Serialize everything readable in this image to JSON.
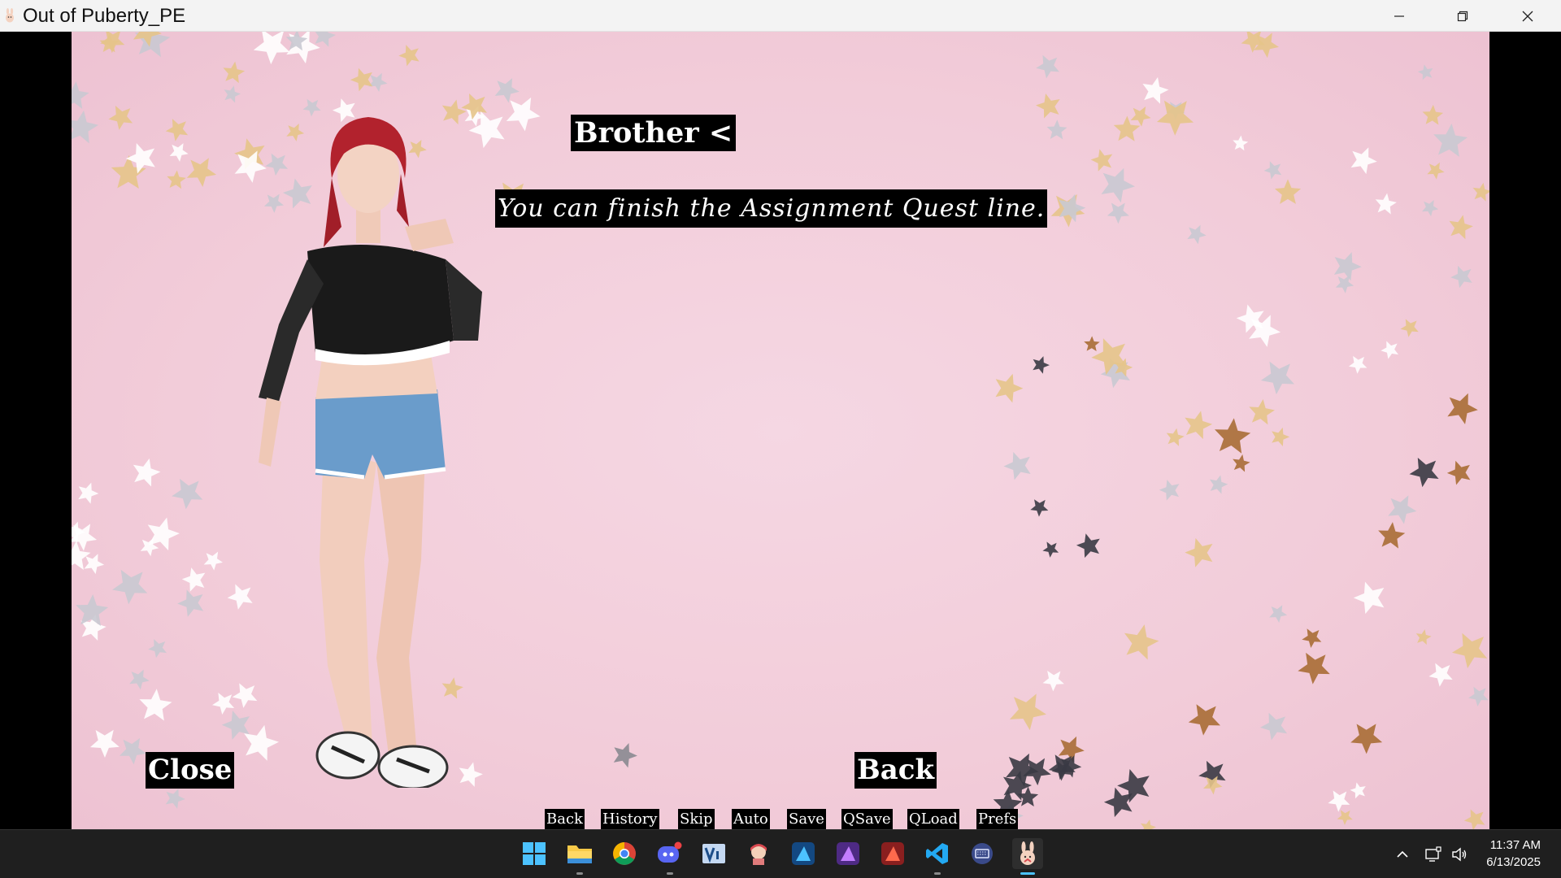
{
  "window": {
    "title": "Out of Puberty_PE",
    "controls": [
      "minimize-icon",
      "restore-icon",
      "close-icon"
    ]
  },
  "game": {
    "speaker": "Brother <",
    "dialogue": "You can finish the Assignment Quest line.",
    "close_label": "Close",
    "back_label": "Back",
    "quick_menu": [
      "Back",
      "History",
      "Skip",
      "Auto",
      "Save",
      "QSave",
      "QLoad",
      "Prefs"
    ],
    "background": "pink-with-gold-and-silver-stars",
    "character": "red-haired-girl-black-top-denim-shorts"
  },
  "taskbar": {
    "apps": [
      "windows-start-icon",
      "file-explorer-icon",
      "chrome-icon",
      "discord-icon",
      "vi-app-icon",
      "anime-avatar-icon",
      "affinity-designer-icon",
      "affinity-photo-icon",
      "affinity-publisher-icon",
      "vscode-icon",
      "keyboard-app-icon",
      "game-bunny-icon"
    ],
    "time": "11:37 AM",
    "date": "6/13/2025"
  },
  "colors": {
    "background_pink": "#f2ccd9",
    "gold_star": "#e6c48a",
    "silver_star": "#c9c9d1",
    "dark_star": "#3a3a44",
    "taskbar": "#1f1f1f"
  }
}
